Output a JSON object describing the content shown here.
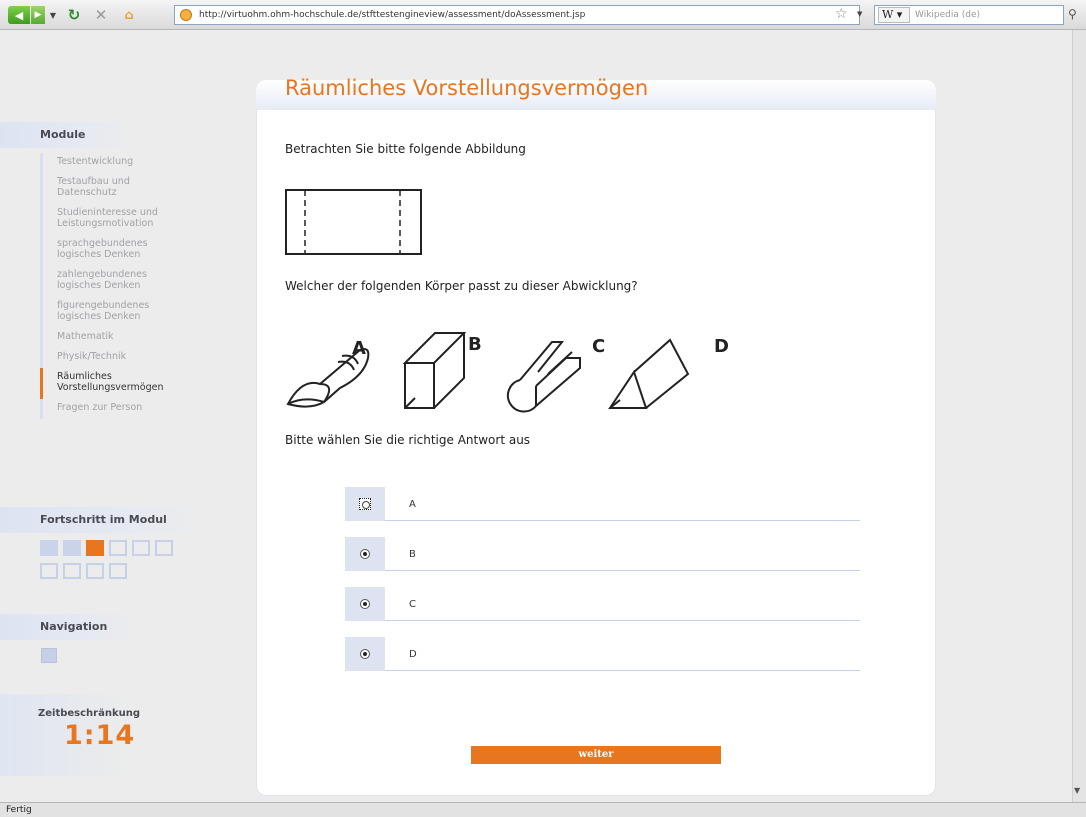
{
  "browser": {
    "url": "http://virtuohm.ohm-hochschule.de/stfttestengineview/assessment/doAssessment.jsp",
    "search_engine": "W",
    "search_placeholder": "Wikipedia (de)",
    "status": "Fertig"
  },
  "sidebar": {
    "module_heading": "Module",
    "items": [
      {
        "label": "Testentwicklung",
        "active": false
      },
      {
        "label": "Testaufbau und\nDatenschutz",
        "active": false
      },
      {
        "label": "Studieninteresse und\nLeistungsmotivation",
        "active": false
      },
      {
        "label": "sprachgebundenes\nlogisches Denken",
        "active": false
      },
      {
        "label": "zahlengebundenes\nlogisches Denken",
        "active": false
      },
      {
        "label": "figurengebundenes\nlogisches Denken",
        "active": false
      },
      {
        "label": "Mathematik",
        "active": false
      },
      {
        "label": "Physik/Technik",
        "active": false
      },
      {
        "label": "Räumliches\nVorstellungsvermögen",
        "active": true
      },
      {
        "label": "Fragen zur Person",
        "active": false
      }
    ],
    "progress_heading": "Fortschritt im Modul",
    "progress": {
      "total": 10,
      "completed": 2,
      "current": 3
    },
    "navigation_heading": "Navigation",
    "time_heading": "Zeitbeschränkung",
    "time_value": "1:14"
  },
  "main": {
    "title": "Räumliches Vorstellungsvermögen",
    "prompt1": "Betrachten Sie bitte folgende Abbildung",
    "prompt2": "Welcher der folgenden Körper passt zu dieser Abwicklung?",
    "shape_labels": [
      "A",
      "B",
      "C",
      "D"
    ],
    "prompt3": "Bitte wählen Sie die richtige Antwort aus",
    "answers": [
      "A",
      "B",
      "C",
      "D"
    ],
    "selected_answer": "A",
    "submit_label": "weiter"
  },
  "colors": {
    "accent": "#e8761e",
    "sidebar_tint": "#dde3f1",
    "progress_done": "#c9d3ea"
  }
}
